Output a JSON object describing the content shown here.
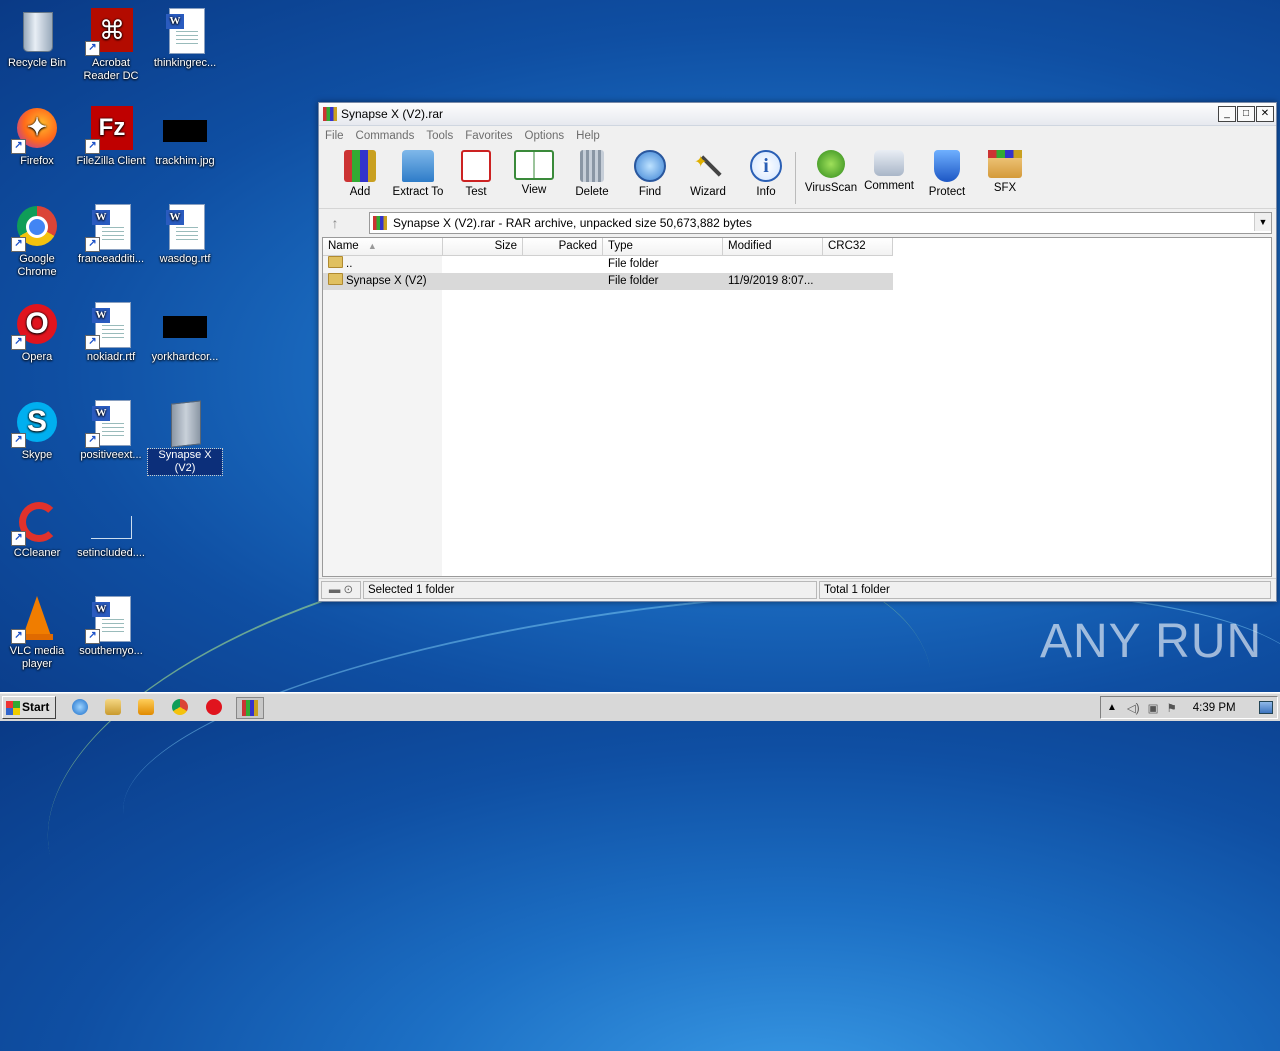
{
  "desktop": {
    "icons": [
      {
        "label": "Recycle Bin"
      },
      {
        "label": "Acrobat Reader DC"
      },
      {
        "label": "thinkingrec..."
      },
      {
        "label": "Firefox"
      },
      {
        "label": "FileZilla Client"
      },
      {
        "label": "trackhim.jpg"
      },
      {
        "label": "Google Chrome"
      },
      {
        "label": "franceadditi..."
      },
      {
        "label": "wasdog.rtf"
      },
      {
        "label": "Opera"
      },
      {
        "label": "nokiadr.rtf"
      },
      {
        "label": "yorkhardcor..."
      },
      {
        "label": "Skype"
      },
      {
        "label": "positiveext..."
      },
      {
        "label": "Synapse X (V2)"
      },
      {
        "label": "CCleaner"
      },
      {
        "label": "setincluded...."
      },
      {
        "label": "VLC media player"
      },
      {
        "label": "southernyo..."
      }
    ]
  },
  "window": {
    "title": "Synapse X (V2).rar",
    "controls": {
      "minimize": "_",
      "maximize": "□",
      "close": "✕"
    },
    "menu": [
      "File",
      "Commands",
      "Tools",
      "Favorites",
      "Options",
      "Help"
    ],
    "toolbar": [
      "Add",
      "Extract To",
      "Test",
      "View",
      "Delete",
      "Find",
      "Wizard",
      "Info",
      "VirusScan",
      "Comment",
      "Protect",
      "SFX"
    ],
    "address": "Synapse X (V2).rar - RAR archive, unpacked size 50,673,882 bytes",
    "columns": [
      "Name",
      "Size",
      "Packed",
      "Type",
      "Modified",
      "CRC32"
    ],
    "rows": [
      {
        "name": "..",
        "size": "",
        "packed": "",
        "type": "File folder",
        "modified": "",
        "crc": ""
      },
      {
        "name": "Synapse X (V2)",
        "size": "",
        "packed": "",
        "type": "File folder",
        "modified": "11/9/2019 8:07...",
        "crc": ""
      }
    ],
    "status_left": "Selected 1 folder",
    "status_right": "Total 1 folder"
  },
  "taskbar": {
    "start_label": "Start",
    "clock": "4:39 PM"
  },
  "watermark": "ANY RUN",
  "colors": {
    "accent": "#1c6fc4",
    "selection": "#0c2f7a"
  }
}
